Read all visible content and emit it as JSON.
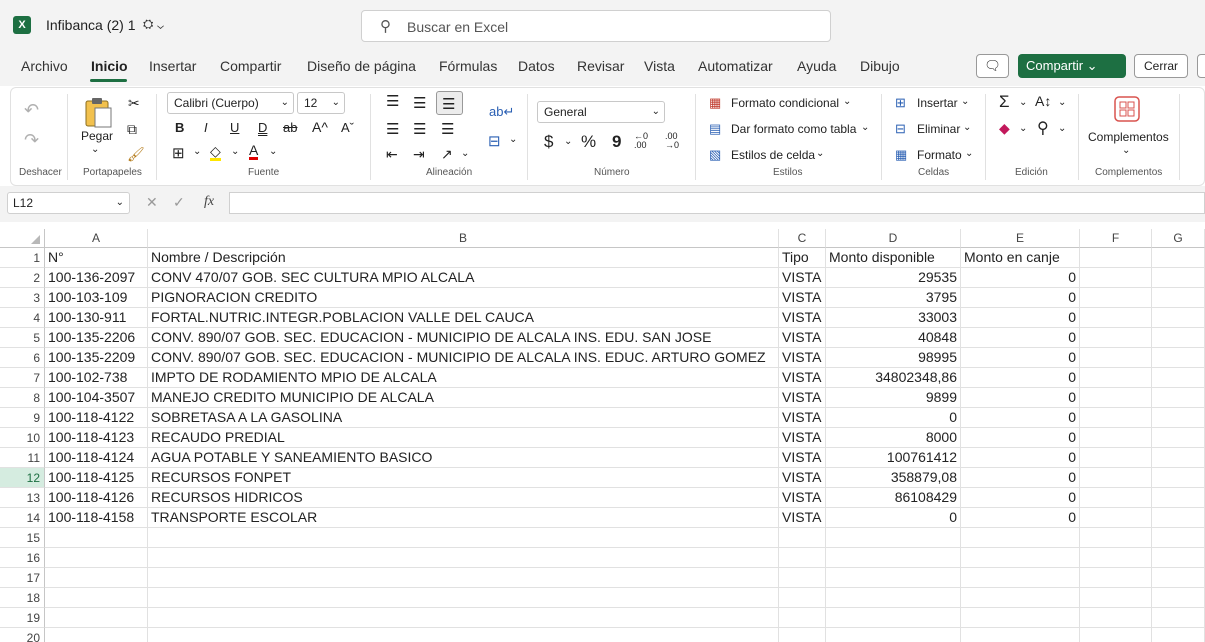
{
  "title": {
    "app_icon": "X",
    "doc": "Infibanca (2) 1",
    "status_icons": "⛭ ⌄"
  },
  "search": {
    "icon": "⚲",
    "placeholder": "Buscar en Excel"
  },
  "menu": [
    "Archivo",
    "Inicio",
    "Insertar",
    "Compartir",
    "Diseño de página",
    "Fórmulas",
    "Datos",
    "Revisar",
    "Vista",
    "Automatizar",
    "Ayuda",
    "Dibujo"
  ],
  "header_buttons": {
    "comment_icon": "🗨",
    "share": "Compartir ⌄",
    "close": "Cerrar"
  },
  "ribbon": {
    "undo_label": "Deshacer",
    "clipboard": {
      "paste": "Pegar",
      "label": "Portapapeles"
    },
    "font": {
      "name": "Calibri (Cuerpo)",
      "size": "12",
      "label": "Fuente",
      "bold": "B",
      "italic": "I",
      "underline": "U",
      "double_underline": "D",
      "strike": "ab",
      "grow": "A^",
      "shrink": "Aˇ"
    },
    "alignment": {
      "label": "Alineación"
    },
    "number": {
      "format": "General",
      "label": "Número",
      "currency": "$",
      "percent": "%",
      "comma": "9"
    },
    "styles": {
      "conditional": "Formato condicional",
      "table": "Dar formato como tabla",
      "cell_styles": "Estilos de celda",
      "label": "Estilos"
    },
    "cells": {
      "insert": "Insertar",
      "delete": "Eliminar",
      "format": "Formato",
      "label": "Celdas"
    },
    "editing": {
      "label": "Edición"
    },
    "addins": {
      "button": "Complementos",
      "label": "Complementos"
    }
  },
  "formula_bar": {
    "name_box": "L12",
    "value": ""
  },
  "sheet": {
    "columns": [
      "A",
      "B",
      "C",
      "D",
      "E",
      "F",
      "G"
    ],
    "rows": [
      {
        "n": "1",
        "a": "N°",
        "b": "Nombre / Descripción",
        "c": "Tipo",
        "d": "Monto disponible",
        "e": "Monto en canje"
      },
      {
        "n": "2",
        "a": "100-136-2097",
        "b": "CONV 470/07 GOB. SEC CULTURA MPIO ALCALA",
        "c": "VISTA",
        "d": "29535",
        "e": "0"
      },
      {
        "n": "3",
        "a": "100-103-109",
        "b": "PIGNORACION CREDITO",
        "c": "VISTA",
        "d": "3795",
        "e": "0"
      },
      {
        "n": "4",
        "a": "100-130-911",
        "b": "FORTAL.NUTRIC.INTEGR.POBLACION VALLE DEL CAUCA",
        "c": "VISTA",
        "d": "33003",
        "e": "0"
      },
      {
        "n": "5",
        "a": "100-135-2206",
        "b": "CONV. 890/07 GOB. SEC. EDUCACION - MUNICIPIO DE ALCALA INS. EDU. SAN JOSE",
        "c": "VISTA",
        "d": "40848",
        "e": "0"
      },
      {
        "n": "6",
        "a": "100-135-2209",
        "b": "CONV. 890/07 GOB. SEC. EDUCACION - MUNICIPIO DE ALCALA INS. EDUC. ARTURO GOMEZ",
        "c": "VISTA",
        "d": "98995",
        "e": "0"
      },
      {
        "n": "7",
        "a": "100-102-738",
        "b": "IMPTO DE RODAMIENTO MPIO DE ALCALA",
        "c": "VISTA",
        "d": "34802348,86",
        "e": "0"
      },
      {
        "n": "8",
        "a": "100-104-3507",
        "b": "MANEJO CREDITO MUNICIPIO DE ALCALA",
        "c": "VISTA",
        "d": "9899",
        "e": "0"
      },
      {
        "n": "9",
        "a": "100-118-4122",
        "b": "SOBRETASA A LA GASOLINA",
        "c": "VISTA",
        "d": "0",
        "e": "0"
      },
      {
        "n": "10",
        "a": "100-118-4123",
        "b": "RECAUDO PREDIAL",
        "c": "VISTA",
        "d": "8000",
        "e": "0"
      },
      {
        "n": "11",
        "a": "100-118-4124",
        "b": "AGUA POTABLE Y SANEAMIENTO BASICO",
        "c": "VISTA",
        "d": "100761412",
        "e": "0"
      },
      {
        "n": "12",
        "a": "100-118-4125",
        "b": "RECURSOS FONPET",
        "c": "VISTA",
        "d": "358879,08",
        "e": "0"
      },
      {
        "n": "13",
        "a": "100-118-4126",
        "b": "RECURSOS HIDRICOS",
        "c": "VISTA",
        "d": "86108429",
        "e": "0"
      },
      {
        "n": "14",
        "a": "100-118-4158",
        "b": "TRANSPORTE ESCOLAR",
        "c": "VISTA",
        "d": "0",
        "e": "0"
      },
      {
        "n": "15",
        "a": "",
        "b": "",
        "c": "",
        "d": "",
        "e": ""
      },
      {
        "n": "16",
        "a": "",
        "b": "",
        "c": "",
        "d": "",
        "e": ""
      },
      {
        "n": "17",
        "a": "",
        "b": "",
        "c": "",
        "d": "",
        "e": ""
      },
      {
        "n": "18",
        "a": "",
        "b": "",
        "c": "",
        "d": "",
        "e": ""
      },
      {
        "n": "19",
        "a": "",
        "b": "",
        "c": "",
        "d": "",
        "e": ""
      },
      {
        "n": "20",
        "a": "",
        "b": "",
        "c": "",
        "d": "",
        "e": ""
      }
    ],
    "selected_row": "12"
  }
}
